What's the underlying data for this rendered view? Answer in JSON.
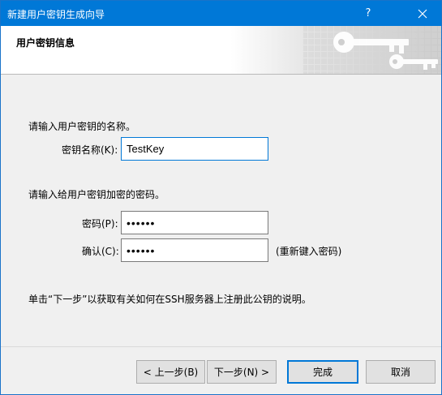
{
  "window": {
    "title": "新建用户密钥生成向导",
    "help_label": "?",
    "close_label": "✕"
  },
  "banner": {
    "title": "用户密钥信息"
  },
  "form": {
    "name_prompt": "请输入用户密钥的名称。",
    "name_label": "密钥名称(K):",
    "name_value": "TestKey",
    "password_prompt": "请输入给用户密钥加密的密码。",
    "password_label": "密码(P):",
    "password_value": "••••••",
    "confirm_label": "确认(C):",
    "confirm_value": "••••••",
    "confirm_hint": "(重新键入密码)",
    "info_text": "单击“下一步”以获取有关如何在SSH服务器上注册此公钥的说明。"
  },
  "buttons": {
    "back": "< 上一步(B)",
    "next": "下一步(N) >",
    "finish": "完成",
    "cancel": "取消"
  },
  "colors": {
    "titlebar": "#0078d7",
    "accent": "#0078d7"
  }
}
